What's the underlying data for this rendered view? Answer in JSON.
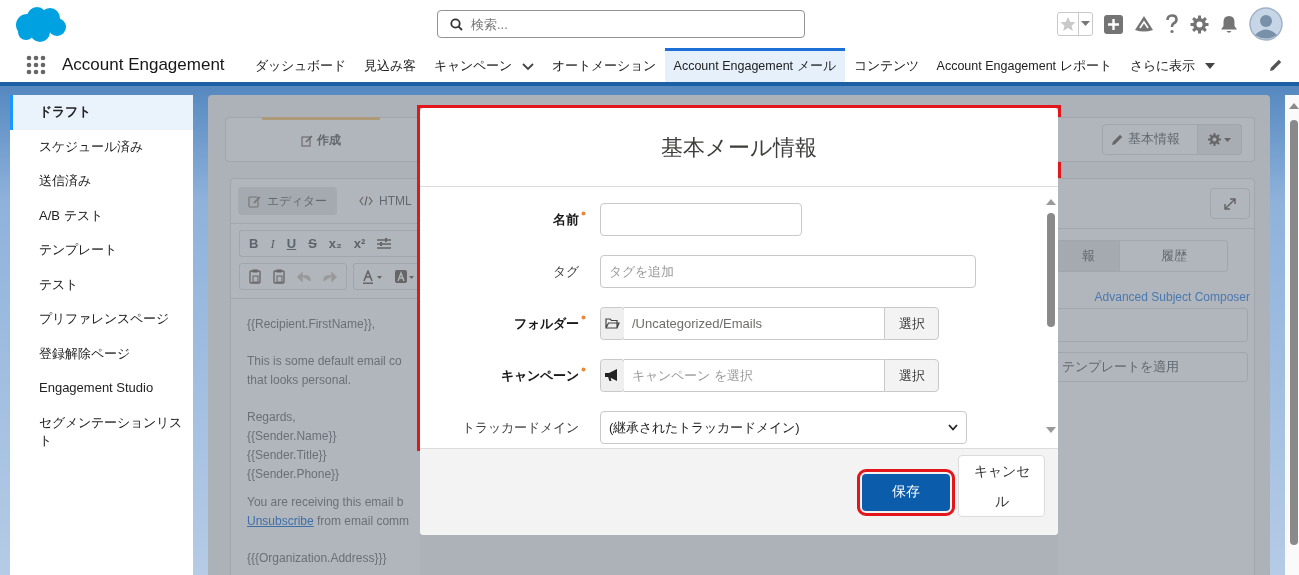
{
  "header": {
    "search": {
      "placeholder": "検索..."
    },
    "app_name": "Account Engagement",
    "nav_tabs": [
      {
        "label": "ダッシュボード",
        "selected": false,
        "kind": "tab"
      },
      {
        "label": "見込み客",
        "selected": false,
        "kind": "tab"
      },
      {
        "label": "キャンペーン",
        "selected": false,
        "kind": "menu"
      },
      {
        "label": "オートメーション",
        "selected": false,
        "kind": "tab"
      },
      {
        "label": "Account Engagement メール",
        "selected": true,
        "kind": "tab"
      },
      {
        "label": "コンテンツ",
        "selected": false,
        "kind": "tab"
      },
      {
        "label": "Account Engagement レポート",
        "selected": false,
        "kind": "tab"
      },
      {
        "label": "さらに表示",
        "selected": false,
        "kind": "more"
      }
    ]
  },
  "sidebar": {
    "items": [
      {
        "label": "ドラフト",
        "selected": true
      },
      {
        "label": "スケジュール済み",
        "selected": false
      },
      {
        "label": "送信済み",
        "selected": false
      },
      {
        "label": "A/B テスト",
        "selected": false
      },
      {
        "label": "テンプレート",
        "selected": false
      },
      {
        "label": "テスト",
        "selected": false
      },
      {
        "label": "プリファレンスページ",
        "selected": false
      },
      {
        "label": "登録解除ページ",
        "selected": false
      },
      {
        "label": "Engagement Studio",
        "selected": false
      },
      {
        "label": "セグメンテーションリスト",
        "selected": false
      }
    ]
  },
  "composer": {
    "steps": [
      {
        "label": "作成",
        "selected": true
      }
    ],
    "editor_tabs": [
      {
        "label": "エディター",
        "selected": true
      },
      {
        "label": "HTML",
        "selected": false
      }
    ],
    "format_buttons": [
      {
        "label": "B",
        "kind": "bold"
      },
      {
        "label": "I",
        "kind": "italic"
      },
      {
        "label": "U",
        "kind": "underline"
      },
      {
        "label": "S",
        "kind": "strikethrough"
      },
      {
        "label": "x₂",
        "kind": "subscript"
      },
      {
        "label": "x²",
        "kind": "superscript"
      }
    ],
    "body": [
      {
        "lines": [
          "{{Recipient.FirstName}},"
        ]
      },
      {
        "lines": [
          "This is some default email co",
          "that looks personal."
        ]
      },
      {
        "lines": [
          "Regards,",
          "{{Sender.Name}}",
          "{{Sender.Title}}",
          "{{Sender.Phone}}"
        ]
      },
      {
        "lines": [
          "You are receiving this email b"
        ],
        "link": "Unsubscribe",
        "link_tail": " from email comm"
      },
      {
        "lines": [
          "{{{Organization.Address}}}"
        ]
      }
    ]
  },
  "settings_panel": {
    "info_button": "基本情報",
    "tabs": [
      {
        "label": "報",
        "selected": true
      },
      {
        "label": "履歴",
        "selected": false
      }
    ],
    "link": "Advanced Subject Composer",
    "template_button": "テンプレートを適用"
  },
  "modal": {
    "title": "基本メール情報",
    "highlighted": true,
    "fields": [
      {
        "label": "名前",
        "required": true,
        "kind": "text"
      },
      {
        "label": "タグ",
        "required": false,
        "kind": "tags",
        "placeholder": "タグを追加"
      },
      {
        "label": "フォルダー",
        "required": true,
        "kind": "folder",
        "value": "/Uncategorized/Emails",
        "button": "選択"
      },
      {
        "label": "キャンペーン",
        "required": true,
        "kind": "campaign",
        "placeholder": "キャンペーン を選択",
        "button": "選択"
      },
      {
        "label": "トラッカードメイン",
        "required": false,
        "kind": "select",
        "value": "(継承されたトラッカードメイン)"
      }
    ],
    "save_button": {
      "label": "保存",
      "highlighted": true
    },
    "cancel_button": "キャンセル"
  }
}
